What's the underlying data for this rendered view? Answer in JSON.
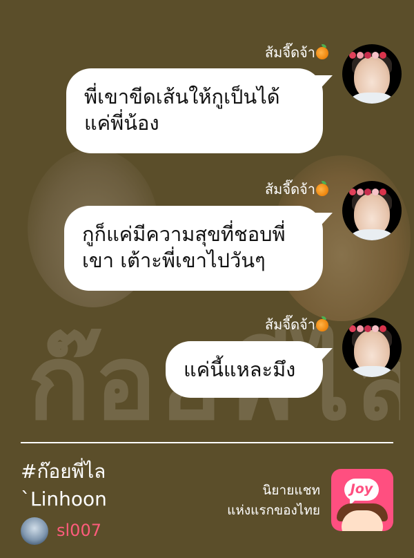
{
  "chat": {
    "messages": [
      {
        "sender": "ส้มจี๊ดจ้า",
        "lines": [
          "พี่เขาขีดเส้นให้กูเป็นได้",
          "แค่พี่น้อง"
        ]
      },
      {
        "sender": "ส้มจี๊ดจ้า",
        "lines": [
          "กูก็แค่มีความสุขที่ชอบพี่",
          "เขา เต้าะพี่เขาไปวันๆ"
        ]
      },
      {
        "sender": "ส้มจี๊ดจ้า",
        "lines": [
          "แค่นี้แหละมึง"
        ]
      }
    ],
    "sender_emoji": "orange-emoji",
    "background_title": "ก๊อยพี่ไล"
  },
  "footer": {
    "hashtag": "#ก๊อยพี่ไล",
    "author": "`Linhoon",
    "writer_name": "sl007",
    "tagline_line1": "นิยายแชท",
    "tagline_line2": "แห่งแรกของไทย",
    "app_logo_text": "Joy"
  },
  "colors": {
    "background": "#5b4e2a",
    "bubble": "#ffffff",
    "writer_name": "#ff5c7c",
    "joy_brand": "#ff4f80"
  }
}
